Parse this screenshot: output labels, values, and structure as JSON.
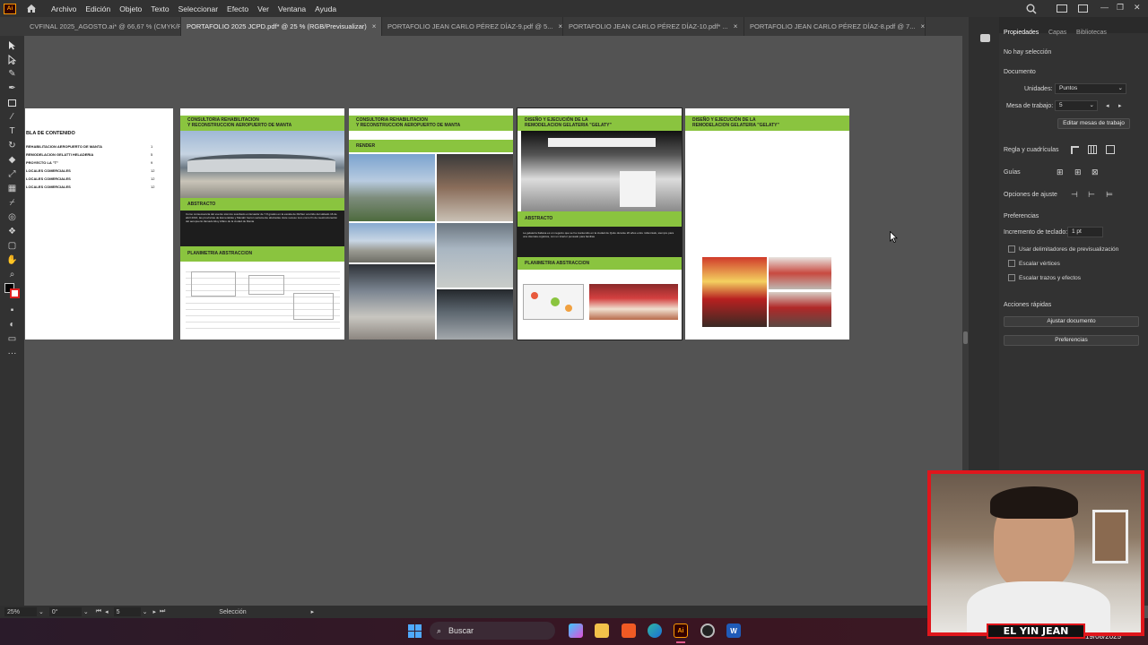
{
  "menubar": {
    "app_icon_label": "Ai",
    "items": [
      "Archivo",
      "Edición",
      "Objeto",
      "Texto",
      "Seleccionar",
      "Efecto",
      "Ver",
      "Ventana",
      "Ayuda"
    ]
  },
  "tabs": [
    {
      "label": "CVFINAL 2025_AGOSTO.ai* @ 66,67 % (CMYK/Pre...",
      "close": "×",
      "active": false
    },
    {
      "label": "PORTAFOLIO 2025 JCPD.pdf* @ 25 % (RGB/Previsualizar)",
      "close": "×",
      "active": true
    },
    {
      "label": "PORTAFOLIO JEAN CARLO PÉREZ DÍAZ-9.pdf @ 5...",
      "close": "×",
      "active": false
    },
    {
      "label": "PORTAFOLIO JEAN CARLO PÉREZ DÍAZ-10.pdf* ...",
      "close": "×",
      "active": false
    },
    {
      "label": "PORTAFOLIO JEAN CARLO PÉREZ DÍAZ-8.pdf @ 7...",
      "close": "×",
      "active": false
    }
  ],
  "pages": {
    "toc": {
      "title": "BLA DE CONTENIDO",
      "items": [
        {
          "label": "REHABILITACION AEROPUERTO DE MANTA",
          "num": "1"
        },
        {
          "label": "REMODELACION GELATTI HELADERIA",
          "num": "5"
        },
        {
          "label": "PROYECTO LA \"T\"",
          "num": "9"
        },
        {
          "label": "LOCALES COMERCIALES",
          "num": "12"
        },
        {
          "label": "LOCALES COMERCIALES",
          "num": "12"
        },
        {
          "label": "LOCALES COMERCIALES",
          "num": "12"
        }
      ]
    },
    "page2": {
      "header": "CONSULTORIA REHABILITACION\nY RECONSTRUCCION AEROPUERTO DE MANTA",
      "abstract_label": "ABSTRACTO",
      "abstract_text": "Como consecuencia del evento sísmico suscitado en Ecuador de 7.8 grados en la escala de Richter ocurrido del sábado 16 de abril 2016, las provincias de Esmeraldas y Manabí fueron seriamente afectadas. Este suceso tuvo como fin de reestructuración del aeropuerto llamado Eloy Alfaro de la ciudad de Manta",
      "plan_label": "PLANIMETRIA ABSTRACCION"
    },
    "page3": {
      "header": "CONSULTORIA REHABILITACION\nY RECONSTRUCCION AEROPUERTO DE MANTA",
      "render_label": "RENDER"
    },
    "page4": {
      "header": "DISEÑO Y EJECUCIÓN DE LA\nREMODELACION GELATERIA \"GELATY\"",
      "abstract_label": "ABSTRACTO",
      "abstract_text": "La gelatería Italiana es un negocio que se ha mantenido en la ciudad de Quito durante 20 años entre millennials, siempre para una clientela orgánica, con un interior pensado para familias",
      "plan_label": "PLANIMETRIA ABSTRACCION"
    },
    "page5": {
      "header": "DISEÑO Y EJECUCIÓN DE LA\nREMODELACION GELATERIA \"GELATY\""
    }
  },
  "panel": {
    "tabs": [
      "Propiedades",
      "Capas",
      "Bibliotecas"
    ],
    "no_selection": "No hay selección",
    "document_section": "Documento",
    "units_label": "Unidades:",
    "units_value": "Puntos",
    "artboard_label": "Mesa de trabajo:",
    "artboard_value": "5",
    "edit_artboards_button": "Editar mesas de trabajo",
    "rulers_label": "Regla y cuadrículas",
    "guides_label": "Guías",
    "snap_label": "Opciones de ajuste",
    "preferences_section": "Preferencias",
    "keyboard_inc_label": "Incremento de teclado:",
    "keyboard_inc_value": "1 pt",
    "checkboxes": [
      "Usar delimitadores de previsualización",
      "Escalar vértices",
      "Escalar trazos y efectos"
    ],
    "quick_actions_section": "Acciones rápidas",
    "fit_document_button": "Ajustar documento",
    "preferences_button": "Preferencias"
  },
  "status": {
    "zoom": "25%",
    "rotation": "0°",
    "artboard_num": "5",
    "tool": "Selección"
  },
  "taskbar": {
    "search_placeholder": "Buscar",
    "date": "19/08/2025"
  },
  "webcam": {
    "name_label": "EL YIN JEAN"
  },
  "colors": {
    "accent_green": "#8ac43f",
    "webcam_border": "#e0161c"
  }
}
